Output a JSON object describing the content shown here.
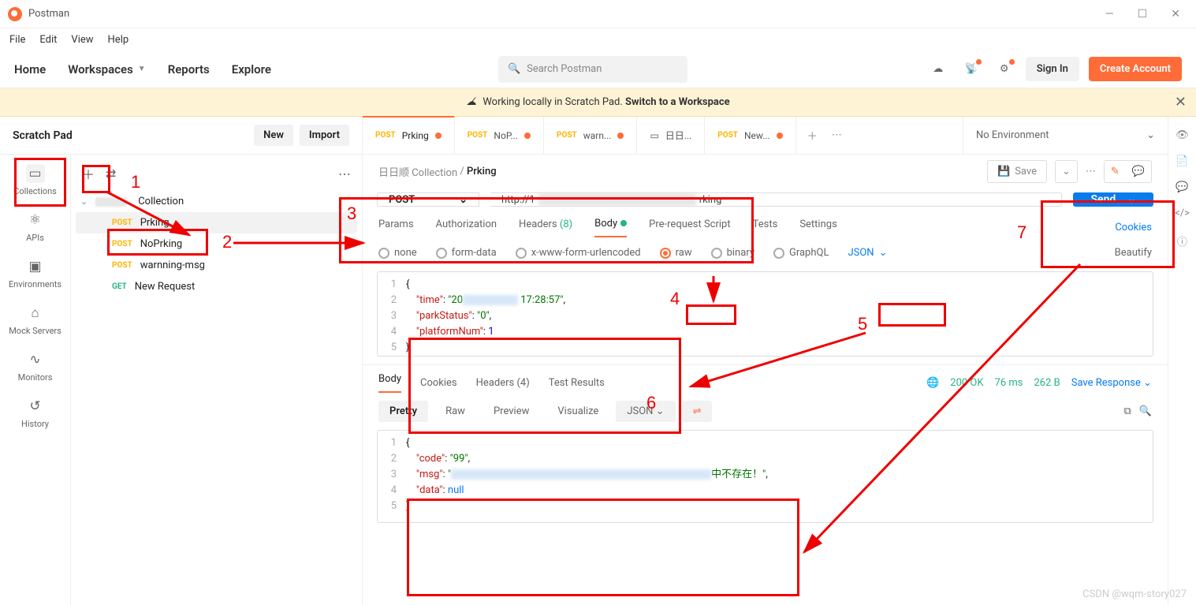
{
  "app": {
    "name": "Postman"
  },
  "menubar": [
    "File",
    "Edit",
    "View",
    "Help"
  ],
  "topnav": {
    "items": [
      "Home",
      "Workspaces",
      "Reports",
      "Explore"
    ],
    "search_placeholder": "Search Postman",
    "signin": "Sign In",
    "create": "Create Account"
  },
  "banner": {
    "text": "Working locally in Scratch Pad.",
    "link": "Switch to a Workspace"
  },
  "left": {
    "title": "Scratch Pad",
    "new": "New",
    "import": "Import",
    "sidenav": [
      {
        "icon": "▭",
        "label": "Collections",
        "active": true
      },
      {
        "icon": "⚛",
        "label": "APIs"
      },
      {
        "icon": "▣",
        "label": "Environments"
      },
      {
        "icon": "⌂",
        "label": "Mock Servers"
      },
      {
        "icon": "∿",
        "label": "Monitors"
      },
      {
        "icon": "↺",
        "label": "History"
      }
    ],
    "collection_suffix": "Collection",
    "requests": [
      {
        "method": "POST",
        "name": "Prking",
        "active": true
      },
      {
        "method": "POST",
        "name": "NoPrking"
      },
      {
        "method": "POST",
        "name": "warnning-msg"
      },
      {
        "method": "GET",
        "name": "New Request"
      }
    ]
  },
  "tabs": [
    {
      "method": "POST",
      "label": "Prking",
      "dirty": true,
      "active": true
    },
    {
      "method": "POST",
      "label": "NoP...",
      "dirty": true
    },
    {
      "method": "POST",
      "label": "warn...",
      "dirty": true
    },
    {
      "icon": "▭",
      "label": "日日..."
    },
    {
      "method": "POST",
      "label": "New...",
      "dirty": true
    }
  ],
  "env": "No Environment",
  "crumb": {
    "parent": "日日顺 Collection",
    "current": "Prking",
    "save": "Save"
  },
  "request": {
    "method": "POST",
    "url_prefix": "http://1",
    "url_suffix": "rking",
    "send": "Send",
    "tabs": [
      "Params",
      "Authorization",
      "Headers",
      "Body",
      "Pre-request Script",
      "Tests",
      "Settings"
    ],
    "headers_count": "(8)",
    "cookies": "Cookies",
    "body_types": [
      "none",
      "form-data",
      "x-www-form-urlencoded",
      "raw",
      "binary",
      "GraphQL"
    ],
    "body_selected": "raw",
    "body_format": "JSON",
    "beautify": "Beautify",
    "body_code": {
      "lines": [
        "1",
        "2",
        "3",
        "4",
        "5"
      ],
      "l1": "{",
      "k_time": "\"time\"",
      "v_time_pre": "\"20",
      "v_time_post": " 17:28:57\"",
      "k_parkStatus": "\"parkStatus\"",
      "v_parkStatus": "\"0\"",
      "k_platformNum": "\"platformNum\"",
      "v_platformNum": "1",
      "l5": "}"
    }
  },
  "response": {
    "tabs": [
      "Body",
      "Cookies",
      "Headers",
      "Test Results"
    ],
    "headers_count": "(4)",
    "status": "200 OK",
    "time": "76 ms",
    "size": "262 B",
    "save": "Save Response",
    "viewmodes": [
      "Pretty",
      "Raw",
      "Preview",
      "Visualize"
    ],
    "format": "JSON",
    "code": {
      "lines": [
        "1",
        "2",
        "3",
        "4",
        "5"
      ],
      "l1": "{",
      "k_code": "\"code\"",
      "v_code": "\"99\"",
      "k_msg": "\"msg\"",
      "v_msg_pre": "\"",
      "v_msg_post": "中不存在！\"",
      "k_data": "\"data\"",
      "v_data": "null",
      "l5": "}"
    }
  },
  "annotations": {
    "n1": "1",
    "n2": "2",
    "n3": "3",
    "n4": "4",
    "n5": "5",
    "n6": "6",
    "n7": "7"
  },
  "watermark": "CSDN @wqm-story027"
}
